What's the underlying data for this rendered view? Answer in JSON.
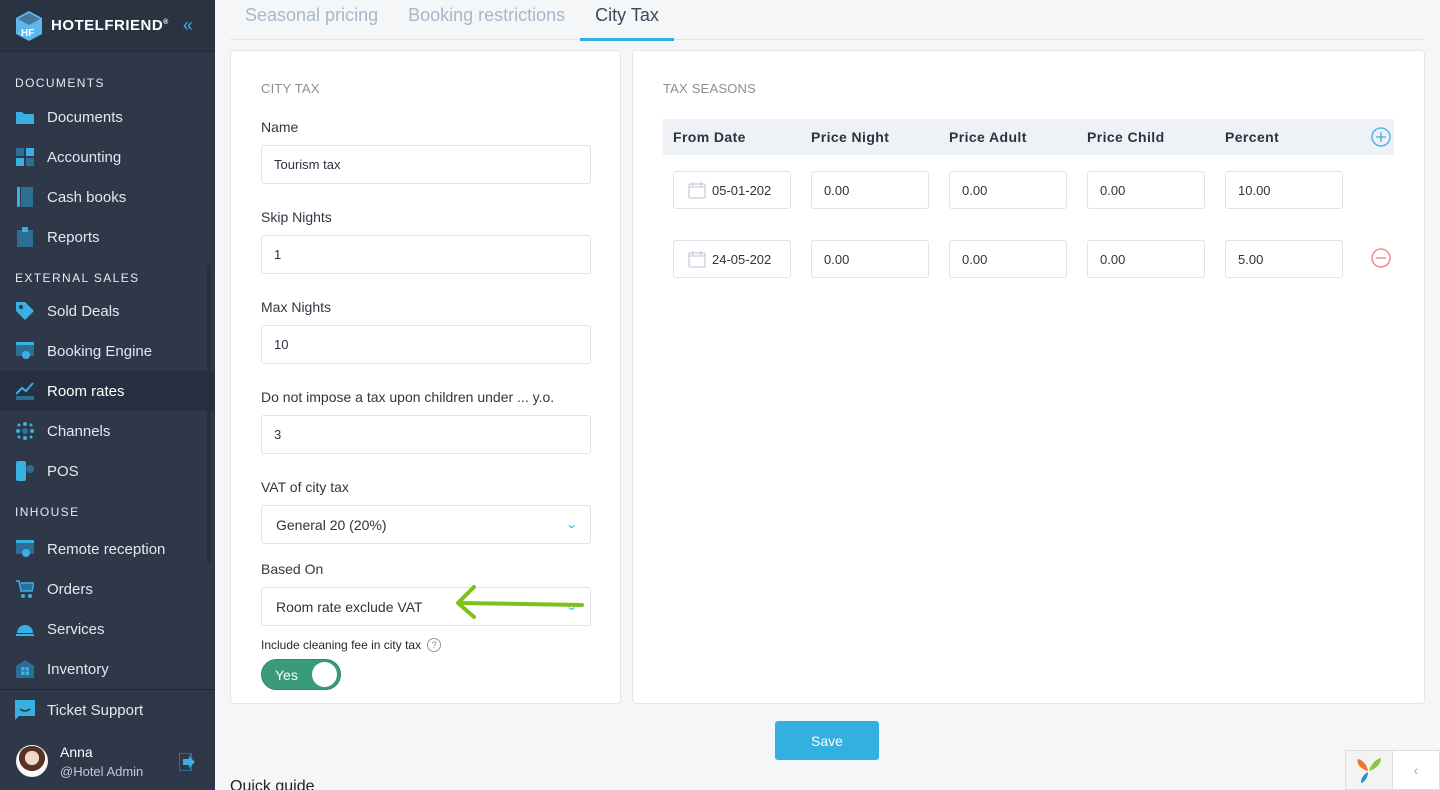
{
  "sidebar": {
    "brand": "HOTELFRIEND",
    "brand_mark": "®",
    "collapse_icon": "«",
    "sections": [
      {
        "title": "DOCUMENTS",
        "items": [
          {
            "label": "Documents",
            "icon": "folder-icon"
          },
          {
            "label": "Accounting",
            "icon": "calculator-icon"
          },
          {
            "label": "Cash books",
            "icon": "cashbook-icon"
          },
          {
            "label": "Reports",
            "icon": "clipboard-chart-icon"
          }
        ]
      },
      {
        "title": "EXTERNAL SALES",
        "items": [
          {
            "label": "Sold Deals",
            "icon": "tag-icon"
          },
          {
            "label": "Booking Engine",
            "icon": "browser-gear-icon"
          },
          {
            "label": "Room rates",
            "icon": "trend-chart-icon",
            "active": true
          },
          {
            "label": "Channels",
            "icon": "network-icon"
          },
          {
            "label": "POS",
            "icon": "mobile-gear-icon"
          }
        ]
      },
      {
        "title": "INHOUSE",
        "items": [
          {
            "label": "Remote reception",
            "icon": "browser-gear-icon"
          },
          {
            "label": "Orders",
            "icon": "cart-icon"
          },
          {
            "label": "Services",
            "icon": "service-bell-icon"
          },
          {
            "label": "Inventory",
            "icon": "house-grid-icon"
          }
        ]
      }
    ],
    "support": {
      "label": "Ticket Support",
      "icon": "chat-icon"
    },
    "user": {
      "name": "Anna",
      "role": "@Hotel Admin"
    }
  },
  "tabs": [
    {
      "label": "Seasonal pricing",
      "active": false
    },
    {
      "label": "Booking restrictions",
      "active": false
    },
    {
      "label": "City Tax",
      "active": true
    }
  ],
  "city_tax": {
    "title": "CITY TAX",
    "name": {
      "label": "Name",
      "value": "Tourism tax"
    },
    "skip_nights": {
      "label": "Skip Nights",
      "value": "1"
    },
    "max_nights": {
      "label": "Max Nights",
      "value": "10"
    },
    "children_age": {
      "label": "Do not impose a tax upon children under ... y.o.",
      "value": "3"
    },
    "vat": {
      "label": "VAT of city tax",
      "value": "General 20 (20%)"
    },
    "based_on": {
      "label": "Based On",
      "value": "Room rate exclude VAT"
    },
    "cleaning_fee": {
      "label": "Include cleaning fee in city tax",
      "help": "?",
      "toggle": "Yes",
      "enabled": true
    }
  },
  "tax_seasons": {
    "title": "TAX SEASONS",
    "columns": [
      "From Date",
      "Price Night",
      "Price Adult",
      "Price Child",
      "Percent"
    ],
    "rows": [
      {
        "from_date": "05-01-202",
        "price_night": "0.00",
        "price_adult": "0.00",
        "price_child": "0.00",
        "percent": "10.00"
      },
      {
        "from_date": "24-05-202",
        "price_night": "0.00",
        "price_adult": "0.00",
        "price_child": "0.00",
        "percent": "5.00"
      }
    ]
  },
  "footer": {
    "save_label": "Save",
    "quick_guide": "Quick guide",
    "debug_toggle": "‹"
  },
  "colors": {
    "accent": "#33b0e0",
    "toggle_on": "#3a9a7c",
    "remove": "#f07c7c",
    "annotation_arrow": "#7dc11a"
  }
}
